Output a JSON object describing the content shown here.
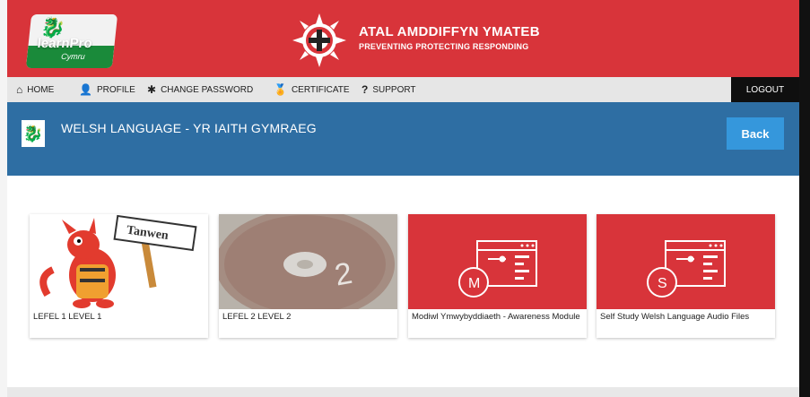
{
  "header": {
    "logo_text": "learnPro",
    "logo_sub": "Cymru",
    "brand_title": "ATAL AMDDIFFYN YMATEB",
    "brand_subtitle": "PREVENTING PROTECTING RESPONDING",
    "accent_color": "#d8343a"
  },
  "nav": {
    "items": [
      {
        "label": "HOME",
        "icon": "home-icon"
      },
      {
        "label": "PROFILE",
        "icon": "user-icon"
      },
      {
        "label": "CHANGE PASSWORD",
        "icon": "asterisk-icon"
      },
      {
        "label": "CERTIFICATE",
        "icon": "certificate-icon"
      },
      {
        "label": "SUPPORT",
        "icon": "question-icon"
      }
    ],
    "logout_label": "LOGOUT"
  },
  "banner": {
    "title": "WELSH LANGUAGE - YR IAITH GYMRAEG",
    "back_label": "Back",
    "color": "#2e6ea3"
  },
  "cards": [
    {
      "label": "LEFEL 1 LEVEL 1",
      "sign_text": "Tanwen"
    },
    {
      "label": "LEFEL 2 LEVEL 2",
      "disc_number": "2"
    },
    {
      "label": "Modiwl Ymwybyddiaeth - Awareness Module",
      "icon_letter": "M"
    },
    {
      "label": "Self Study Welsh Language Audio Files",
      "icon_letter": "S"
    }
  ]
}
